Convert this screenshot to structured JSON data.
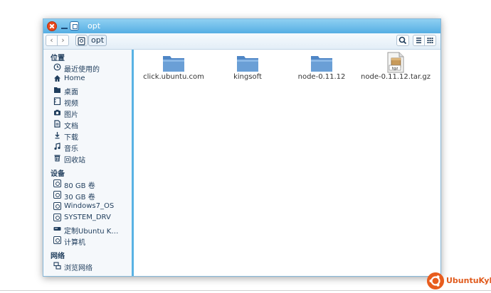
{
  "window": {
    "title": "opt"
  },
  "toolbar": {
    "back_glyph": "‹",
    "forward_glyph": "›",
    "breadcrumb": [
      "opt"
    ]
  },
  "sidebar": {
    "places_header": "位置",
    "places": [
      {
        "label": "最近使用的",
        "icon": "recent-icon"
      },
      {
        "label": "Home",
        "icon": "home-icon"
      },
      {
        "label": "桌面",
        "icon": "desktop-icon"
      },
      {
        "label": "视频",
        "icon": "video-icon"
      },
      {
        "label": "图片",
        "icon": "camera-icon"
      },
      {
        "label": "文档",
        "icon": "document-icon"
      },
      {
        "label": "下载",
        "icon": "download-icon"
      },
      {
        "label": "音乐",
        "icon": "music-icon"
      },
      {
        "label": "回收站",
        "icon": "trash-icon"
      }
    ],
    "devices_header": "设备",
    "devices": [
      {
        "label": "80 GB 卷",
        "eject": true
      },
      {
        "label": "30 GB 卷",
        "eject": false
      },
      {
        "label": "Windows7_OS",
        "eject": true
      },
      {
        "label": "SYSTEM_DRV",
        "eject": false
      },
      {
        "label": "定制Ubuntu K…",
        "eject": true
      },
      {
        "label": "计算机",
        "eject": false
      }
    ],
    "network_header": "网络",
    "network": [
      {
        "label": "浏览网络",
        "icon": "network-icon"
      }
    ]
  },
  "files": [
    {
      "name": "click.ubuntu.com",
      "type": "folder"
    },
    {
      "name": "kingsoft",
      "type": "folder"
    },
    {
      "name": "node-0.11.12",
      "type": "folder"
    },
    {
      "name": "node-0.11.12.tar.gz",
      "type": "archive",
      "badge": "tgz"
    }
  ],
  "branding": {
    "logo_text": "UbuntuKylin"
  },
  "colors": {
    "titlebar": "#55aee3",
    "accent": "#5ab3e4",
    "folder": "#6a9fd6",
    "brand": "#e85d1e"
  }
}
